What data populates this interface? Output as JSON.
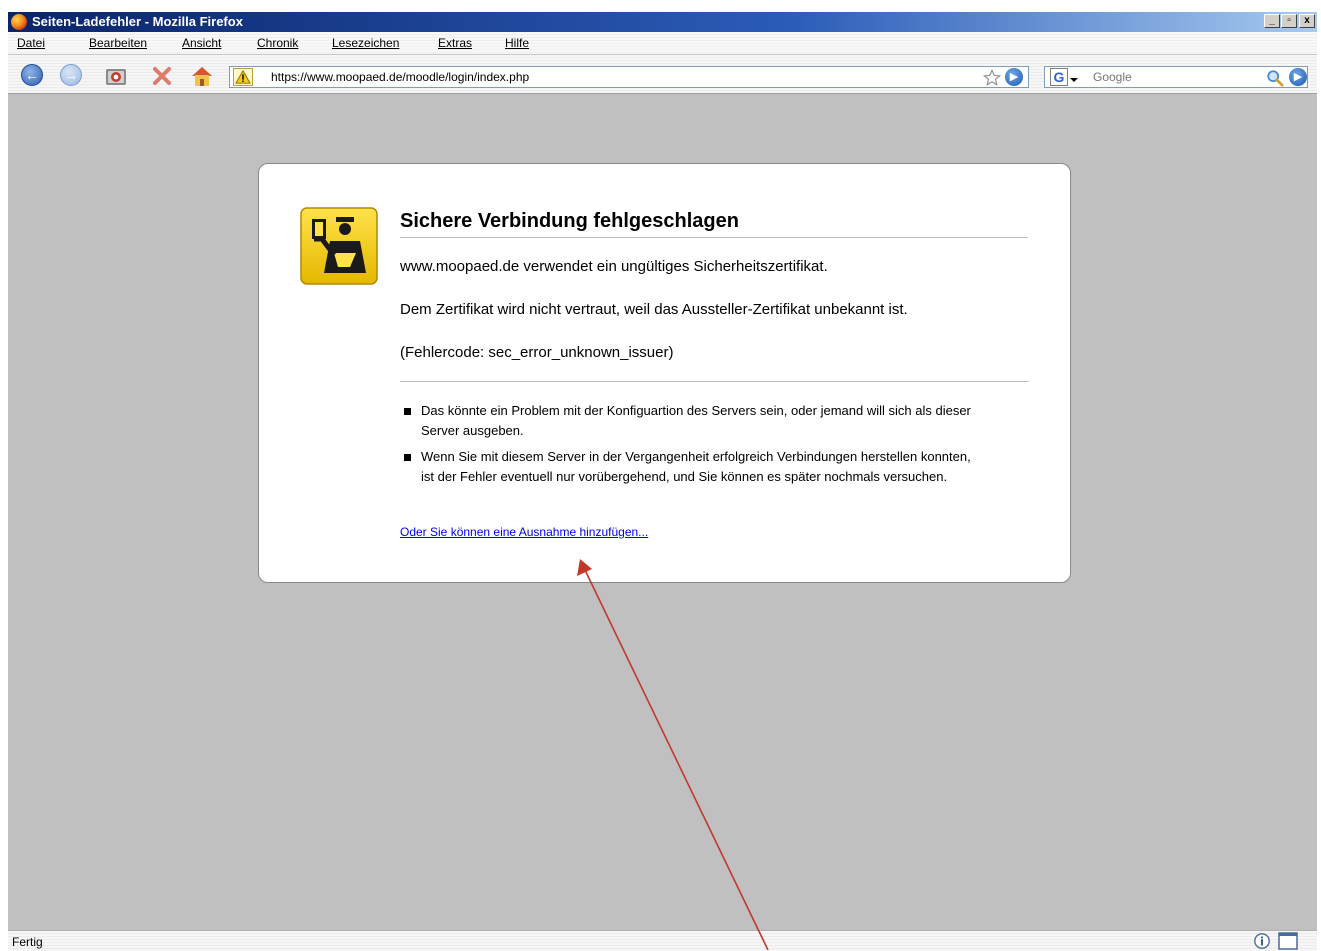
{
  "window": {
    "title": "Seiten-Ladefehler - Mozilla Firefox",
    "controls": {
      "minimize": "_",
      "maximize": "▫",
      "close": "x"
    }
  },
  "menubar": {
    "items": [
      "Datei",
      "Bearbeiten",
      "Ansicht",
      "Chronik",
      "Lesezeichen",
      "Extras",
      "Hilfe"
    ]
  },
  "navbar": {
    "url": "https://www.moopaed.de/moodle/login/index.php",
    "search_placeholder": "Google",
    "icons": [
      "back-icon",
      "forward-icon",
      "reload-icon",
      "stop-icon",
      "home-icon",
      "warning-icon",
      "bookmark-star-icon",
      "go-icon",
      "google-icon",
      "search-icon",
      "search-go-icon"
    ]
  },
  "error_page": {
    "title": "Sichere Verbindung fehlgeschlagen",
    "line1": "www.moopaed.de verwendet ein ungültiges Sicherheitszertifikat.",
    "line2": "Dem Zertifikat wird nicht vertraut, weil das Aussteller-Zertifikat unbekannt ist.",
    "error_code": "(Fehlercode: sec_error_unknown_issuer)",
    "bullets": [
      "Das könnte ein Problem mit der Konfiguartion des Servers sein, oder jemand will sich als dieser Server ausgeben.",
      "Wenn Sie mit diesem Server in der Vergangenheit erfolgreich Verbindungen herstellen konnten, ist der Fehler eventuell nur vorübergehend, und Sie können es später nochmals versuchen."
    ],
    "exception_link": "Oder Sie können eine Ausnahme hinzufügen..."
  },
  "statusbar": {
    "text": "Fertig"
  },
  "colors": {
    "annotation_arrow": "#c0392b",
    "link": "#0000ee",
    "content_bg": "#c0c0c0"
  }
}
